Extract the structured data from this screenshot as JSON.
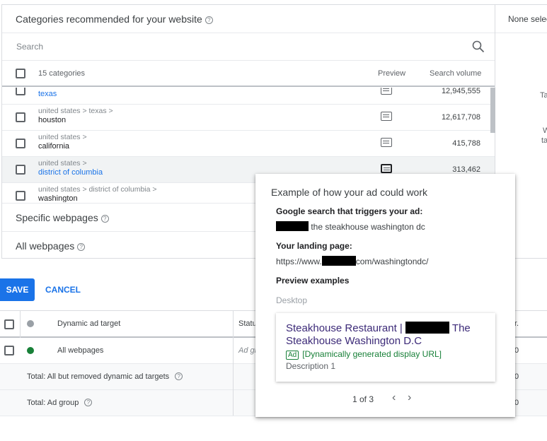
{
  "categories_panel": {
    "title": "Categories recommended for your website",
    "search_placeholder": "Search",
    "col_count": "15 categories",
    "col_preview": "Preview",
    "col_volume": "Search volume",
    "rows": [
      {
        "path": "",
        "name": "texas",
        "volume": "12,945,555"
      },
      {
        "path": "united states > texas >",
        "name": "houston",
        "volume": "12,617,708"
      },
      {
        "path": "united states >",
        "name": "california",
        "volume": "415,788"
      },
      {
        "path": "united states >",
        "name": "district of columbia",
        "volume": "313,462"
      },
      {
        "path": "united states > district of columbia >",
        "name": "washington",
        "volume": ""
      }
    ],
    "specific_webpages": "Specific webpages",
    "all_webpages": "All webpages"
  },
  "right_panel": {
    "header": "None selec",
    "hint1": "Ta",
    "hint2": "W",
    "hint3": "ta"
  },
  "actions": {
    "save": "SAVE",
    "cancel": "CANCEL"
  },
  "targets_table": {
    "col_target": "Dynamic ad target",
    "col_status": "Statu",
    "col_tail": "r.",
    "rows": [
      {
        "target": "All webpages",
        "status": "Ad gr",
        "tail": "0",
        "status_color": "#188038"
      },
      {
        "target": "Total: All but removed dynamic ad targets",
        "status": "",
        "tail": "0"
      },
      {
        "target": "Total: Ad group",
        "status": "",
        "tail": "0"
      }
    ],
    "header_dot_color": "#9aa0a6"
  },
  "preview_popup": {
    "title": "Example of how your ad could work",
    "trigger_label": "Google search that triggers your ad:",
    "trigger_text": "the steakhouse washington dc",
    "landing_label": "Your landing page:",
    "landing_prefix": "https://www.",
    "landing_suffix": "com/washingtondc/",
    "examples_label": "Preview examples",
    "device": "Desktop",
    "ad": {
      "headline_start": "Steakhouse Restaurant |",
      "headline_end": "The Steakhouse Washington D.C",
      "badge": "Ad",
      "display_url": "[Dynamically generated display URL]",
      "description": "Description 1"
    },
    "pager": "1 of 3"
  },
  "icons": {
    "search": "search-icon",
    "help": "help-icon",
    "preview": "preview-icon",
    "prev": "chevron-left-icon",
    "next": "chevron-right-icon"
  }
}
